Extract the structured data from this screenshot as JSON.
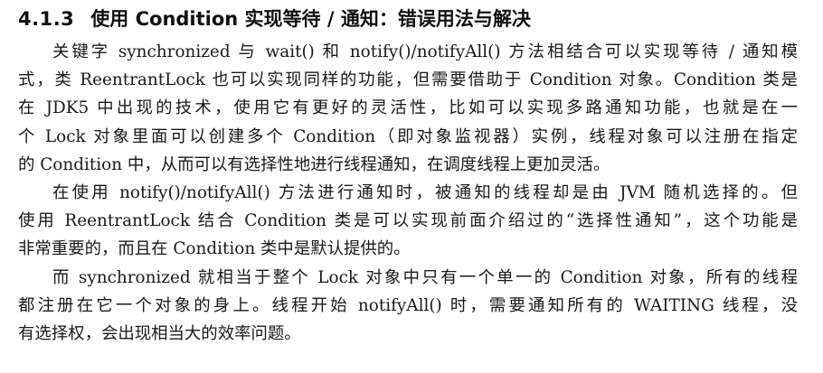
{
  "section": {
    "number": "4.1.3",
    "title": "使用 Condition 实现等待 / 通知：错误用法与解决"
  },
  "paragraphs": [
    {
      "lines": [
        "关键字 synchronized 与 wait() 和 notify()/notifyAll() 方法相结合可以实现等待 / 通知模",
        "式，类 ReentrantLock 也可以实现同样的功能，但需要借助于 Condition 对象。Condition 类是",
        "在 JDK5 中出现的技术，使用它有更好的灵活性，比如可以实现多路通知功能，也就是在一",
        "个 Lock 对象里面可以创建多个 Condition（即对象监视器）实例，线程对象可以注册在指定",
        "的 Condition 中，从而可以有选择性地进行线程通知，在调度线程上更加灵活。"
      ]
    },
    {
      "lines": [
        "在使用 notify()/notifyAll() 方法进行通知时，被通知的线程却是由 JVM 随机选择的。但",
        "使用 ReentrantLock 结合 Condition 类是可以实现前面介绍过的“选择性通知”，这个功能是",
        "非常重要的，而且在 Condition 类中是默认提供的。"
      ]
    },
    {
      "lines": [
        "而 synchronized 就相当于整个 Lock 对象中只有一个单一的 Condition 对象，所有的线程",
        "都注册在它一个对象的身上。线程开始 notifyAll() 时，需要通知所有的 WAITING 线程，没",
        "有选择权，会出现相当大的效率问题。"
      ]
    }
  ]
}
